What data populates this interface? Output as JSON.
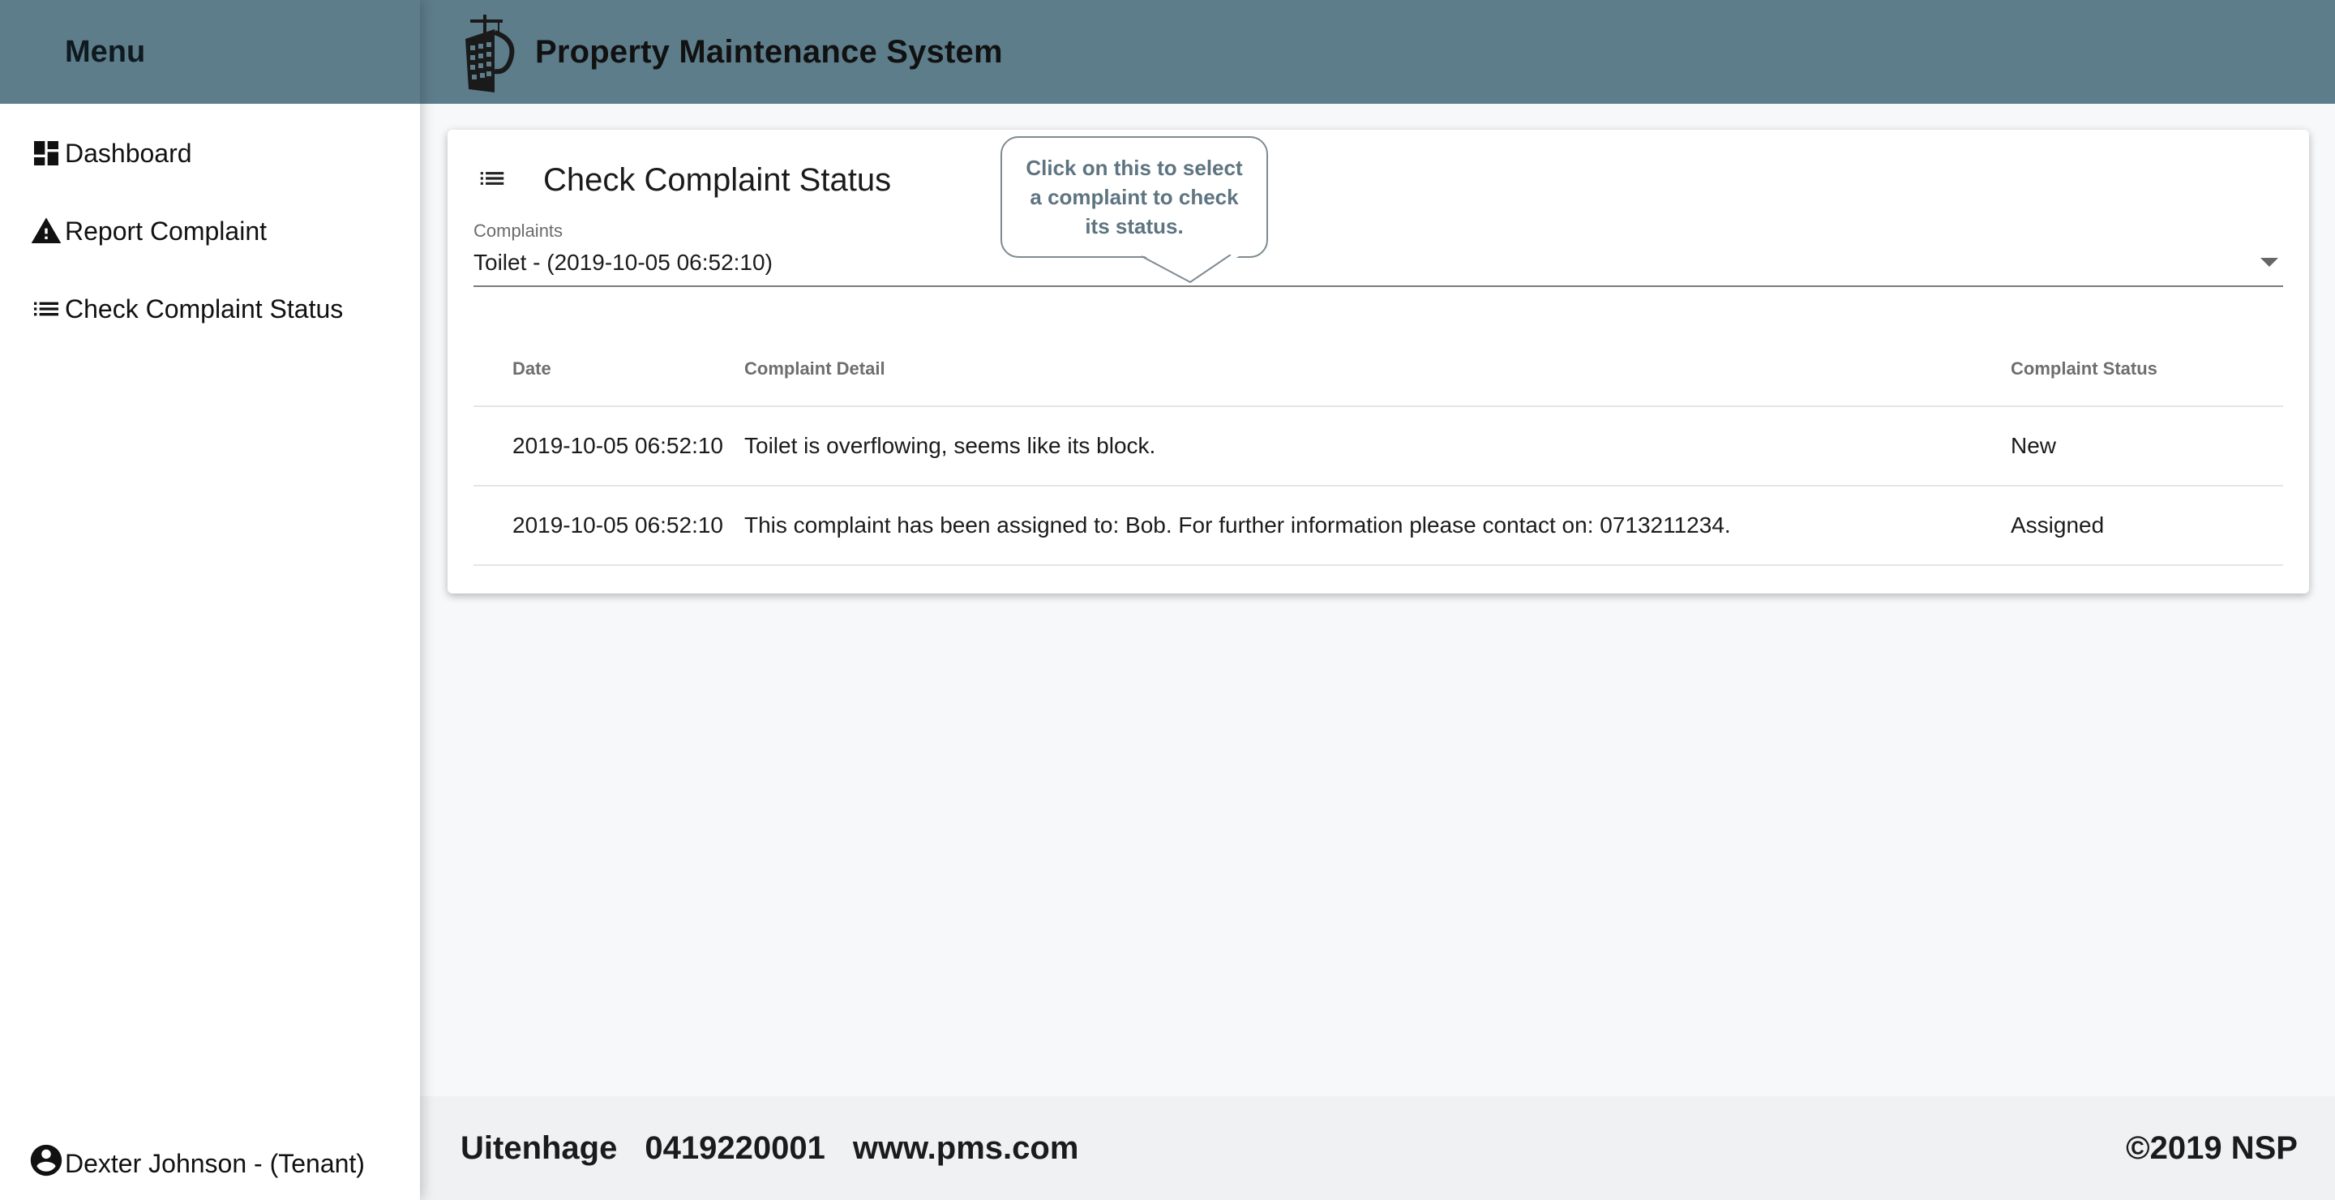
{
  "sidebar": {
    "title": "Menu",
    "items": [
      {
        "label": "Dashboard",
        "icon": "dashboard-icon"
      },
      {
        "label": "Report Complaint",
        "icon": "warning-icon"
      },
      {
        "label": "Check Complaint Status",
        "icon": "list-icon"
      }
    ],
    "user": {
      "label": "Dexter Johnson - (Tenant)",
      "icon": "account-circle-icon"
    }
  },
  "header": {
    "title": "Property Maintenance System",
    "logo_icon": "building-crane-logo"
  },
  "card": {
    "title": "Check Complaint Status",
    "icon": "list-icon",
    "select": {
      "label": "Complaints",
      "value": "Toilet - (2019-10-05 06:52:10)"
    },
    "table": {
      "columns": [
        "Date",
        "Complaint Detail",
        "Complaint Status"
      ],
      "rows": [
        {
          "date": "2019-10-05 06:52:10",
          "detail": "Toilet is overflowing, seems like its block.",
          "status": "New"
        },
        {
          "date": "2019-10-05 06:52:10",
          "detail": "This complaint has been assigned to: Bob. For further information please contact on: 0713211234.",
          "status": "Assigned"
        }
      ]
    }
  },
  "tooltip": {
    "text": "Click on this to select a complaint to check its status."
  },
  "footer": {
    "city": "Uitenhage",
    "phone": "0419220001",
    "website": "www.pms.com",
    "copyright": "©2019 NSP"
  },
  "colors": {
    "header_bg": "#5d7d8b",
    "page_bg": "#f7f8fa",
    "footer_bg": "#f0f1f3",
    "tooltip_text": "#5e7480"
  }
}
